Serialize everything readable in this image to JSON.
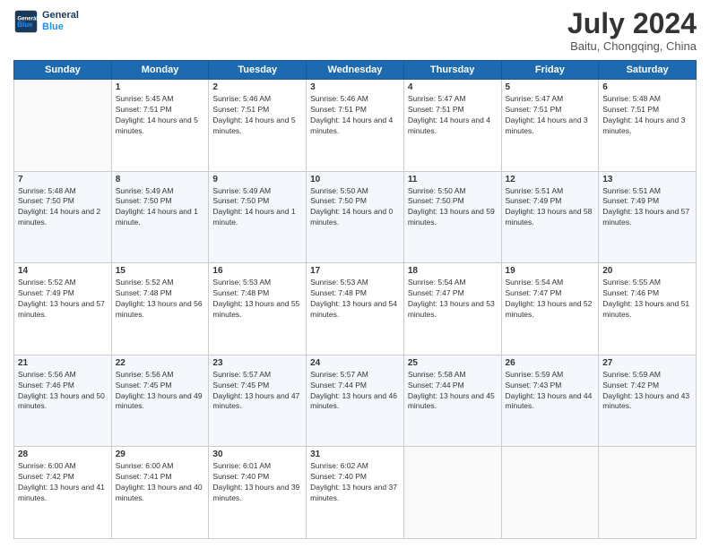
{
  "header": {
    "logo_line1": "General",
    "logo_line2": "Blue",
    "month": "July 2024",
    "location": "Baitu, Chongqing, China"
  },
  "weekdays": [
    "Sunday",
    "Monday",
    "Tuesday",
    "Wednesday",
    "Thursday",
    "Friday",
    "Saturday"
  ],
  "weeks": [
    [
      {
        "day": "",
        "sunrise": "",
        "sunset": "",
        "daylight": ""
      },
      {
        "day": "1",
        "sunrise": "5:45 AM",
        "sunset": "7:51 PM",
        "daylight": "14 hours and 5 minutes."
      },
      {
        "day": "2",
        "sunrise": "5:46 AM",
        "sunset": "7:51 PM",
        "daylight": "14 hours and 5 minutes."
      },
      {
        "day": "3",
        "sunrise": "5:46 AM",
        "sunset": "7:51 PM",
        "daylight": "14 hours and 4 minutes."
      },
      {
        "day": "4",
        "sunrise": "5:47 AM",
        "sunset": "7:51 PM",
        "daylight": "14 hours and 4 minutes."
      },
      {
        "day": "5",
        "sunrise": "5:47 AM",
        "sunset": "7:51 PM",
        "daylight": "14 hours and 3 minutes."
      },
      {
        "day": "6",
        "sunrise": "5:48 AM",
        "sunset": "7:51 PM",
        "daylight": "14 hours and 3 minutes."
      }
    ],
    [
      {
        "day": "7",
        "sunrise": "5:48 AM",
        "sunset": "7:50 PM",
        "daylight": "14 hours and 2 minutes."
      },
      {
        "day": "8",
        "sunrise": "5:49 AM",
        "sunset": "7:50 PM",
        "daylight": "14 hours and 1 minute."
      },
      {
        "day": "9",
        "sunrise": "5:49 AM",
        "sunset": "7:50 PM",
        "daylight": "14 hours and 1 minute."
      },
      {
        "day": "10",
        "sunrise": "5:50 AM",
        "sunset": "7:50 PM",
        "daylight": "14 hours and 0 minutes."
      },
      {
        "day": "11",
        "sunrise": "5:50 AM",
        "sunset": "7:50 PM",
        "daylight": "13 hours and 59 minutes."
      },
      {
        "day": "12",
        "sunrise": "5:51 AM",
        "sunset": "7:49 PM",
        "daylight": "13 hours and 58 minutes."
      },
      {
        "day": "13",
        "sunrise": "5:51 AM",
        "sunset": "7:49 PM",
        "daylight": "13 hours and 57 minutes."
      }
    ],
    [
      {
        "day": "14",
        "sunrise": "5:52 AM",
        "sunset": "7:49 PM",
        "daylight": "13 hours and 57 minutes."
      },
      {
        "day": "15",
        "sunrise": "5:52 AM",
        "sunset": "7:48 PM",
        "daylight": "13 hours and 56 minutes."
      },
      {
        "day": "16",
        "sunrise": "5:53 AM",
        "sunset": "7:48 PM",
        "daylight": "13 hours and 55 minutes."
      },
      {
        "day": "17",
        "sunrise": "5:53 AM",
        "sunset": "7:48 PM",
        "daylight": "13 hours and 54 minutes."
      },
      {
        "day": "18",
        "sunrise": "5:54 AM",
        "sunset": "7:47 PM",
        "daylight": "13 hours and 53 minutes."
      },
      {
        "day": "19",
        "sunrise": "5:54 AM",
        "sunset": "7:47 PM",
        "daylight": "13 hours and 52 minutes."
      },
      {
        "day": "20",
        "sunrise": "5:55 AM",
        "sunset": "7:46 PM",
        "daylight": "13 hours and 51 minutes."
      }
    ],
    [
      {
        "day": "21",
        "sunrise": "5:56 AM",
        "sunset": "7:46 PM",
        "daylight": "13 hours and 50 minutes."
      },
      {
        "day": "22",
        "sunrise": "5:56 AM",
        "sunset": "7:45 PM",
        "daylight": "13 hours and 49 minutes."
      },
      {
        "day": "23",
        "sunrise": "5:57 AM",
        "sunset": "7:45 PM",
        "daylight": "13 hours and 47 minutes."
      },
      {
        "day": "24",
        "sunrise": "5:57 AM",
        "sunset": "7:44 PM",
        "daylight": "13 hours and 46 minutes."
      },
      {
        "day": "25",
        "sunrise": "5:58 AM",
        "sunset": "7:44 PM",
        "daylight": "13 hours and 45 minutes."
      },
      {
        "day": "26",
        "sunrise": "5:59 AM",
        "sunset": "7:43 PM",
        "daylight": "13 hours and 44 minutes."
      },
      {
        "day": "27",
        "sunrise": "5:59 AM",
        "sunset": "7:42 PM",
        "daylight": "13 hours and 43 minutes."
      }
    ],
    [
      {
        "day": "28",
        "sunrise": "6:00 AM",
        "sunset": "7:42 PM",
        "daylight": "13 hours and 41 minutes."
      },
      {
        "day": "29",
        "sunrise": "6:00 AM",
        "sunset": "7:41 PM",
        "daylight": "13 hours and 40 minutes."
      },
      {
        "day": "30",
        "sunrise": "6:01 AM",
        "sunset": "7:40 PM",
        "daylight": "13 hours and 39 minutes."
      },
      {
        "day": "31",
        "sunrise": "6:02 AM",
        "sunset": "7:40 PM",
        "daylight": "13 hours and 37 minutes."
      },
      {
        "day": "",
        "sunrise": "",
        "sunset": "",
        "daylight": ""
      },
      {
        "day": "",
        "sunrise": "",
        "sunset": "",
        "daylight": ""
      },
      {
        "day": "",
        "sunrise": "",
        "sunset": "",
        "daylight": ""
      }
    ]
  ]
}
